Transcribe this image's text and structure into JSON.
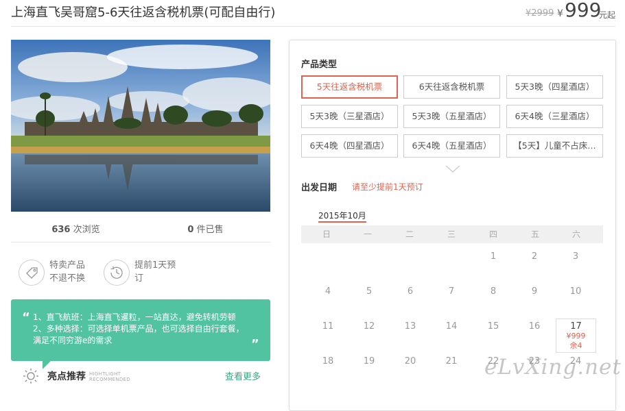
{
  "header": {
    "title": "上海直飞吴哥窟5-6天往返含税机票(可配自由行)",
    "orig_price": "¥2999",
    "currency": "¥",
    "price": "999",
    "price_suffix": "元起"
  },
  "stats": {
    "views_num": "636",
    "views_label": "次浏览",
    "sold_num": "0",
    "sold_label": "件已售"
  },
  "badges": [
    {
      "icon": "tag-icon",
      "line1": "特卖产品",
      "line2": "不退不换"
    },
    {
      "icon": "clock-history-icon",
      "line1": "提前1天预",
      "line2": "订"
    }
  ],
  "highlight_box": {
    "open_quote": "“",
    "close_quote": "”",
    "lines": [
      "1、直飞航班：上海直飞暹粒，一站直达，避免转机劳顿",
      "2、多种选择：可选择单机票产品，也可选择自由行套餐，",
      "满足不同穷游e的需求"
    ]
  },
  "highlights": {
    "title": "亮点推荐",
    "en_line1": "HIGHTLIGHT",
    "en_line2": "RECOMMENDED",
    "more": "查看更多"
  },
  "product_type": {
    "label": "产品类型",
    "options": [
      "5天往返含税机票",
      "6天往返含税机票",
      "5天3晚（四星酒店）",
      "5天3晚（三星酒店）",
      "5天3晚（五星酒店）",
      "6天4晚（三星酒店）",
      "6天4晚（四星酒店）",
      "6天4晚（五星酒店）",
      "【5天】儿童不占床…"
    ],
    "selected_index": 0
  },
  "departure": {
    "label": "出发日期",
    "note": "请至少提前1天预订",
    "month": "2015年10月",
    "weekdays": [
      "日",
      "一",
      "二",
      "三",
      "四",
      "五",
      "六"
    ],
    "rows": [
      [
        "",
        "",
        "",
        "",
        "1",
        "2",
        "3"
      ],
      [
        "4",
        "5",
        "6",
        "7",
        "8",
        "9",
        "10"
      ],
      [
        "11",
        "12",
        "13",
        "14",
        "15",
        "16",
        "17"
      ],
      [
        "18",
        "19",
        "20",
        "21",
        "22",
        "23",
        "24"
      ]
    ],
    "available": {
      "day": "17",
      "price": "¥999",
      "stock": "余4"
    }
  },
  "watermark": "eLvXing.net",
  "colors": {
    "accent": "#e0624e",
    "green_box": "#52c3a1",
    "link_green": "#3aa67f"
  }
}
